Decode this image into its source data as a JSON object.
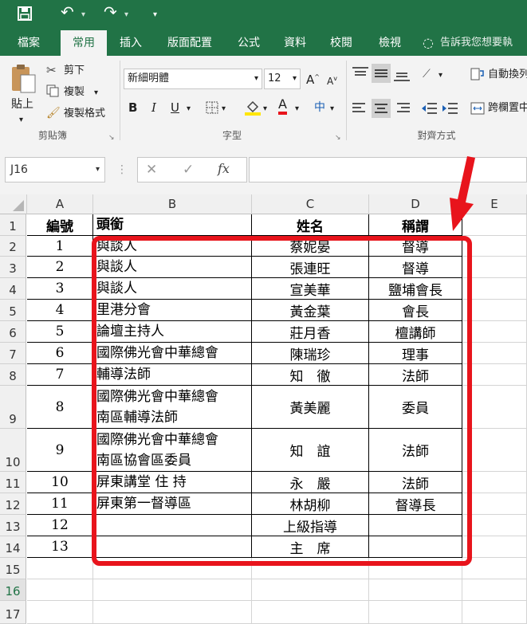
{
  "quick_access": {
    "undo_icon": "↶",
    "redo_icon": "↷"
  },
  "tabs": [
    {
      "label": "檔案"
    },
    {
      "label": "常用"
    },
    {
      "label": "插入"
    },
    {
      "label": "版面配置"
    },
    {
      "label": "公式"
    },
    {
      "label": "資料"
    },
    {
      "label": "校閱"
    },
    {
      "label": "檢視"
    }
  ],
  "tell_me": "告訴我您想要執",
  "ribbon": {
    "clipboard": {
      "paste": "貼上",
      "cut": "剪下",
      "copy": "複製",
      "format_painter": "複製格式",
      "group": "剪貼簿"
    },
    "font": {
      "name": "新細明體",
      "size": "12",
      "bold": "B",
      "italic": "I",
      "underline": "U",
      "font_color_letter": "A",
      "phonetic": "中",
      "group": "字型"
    },
    "alignment": {
      "wrap": "自動換列",
      "merge": "跨欄置中",
      "group": "對齊方式"
    }
  },
  "formula_bar": {
    "name_box": "J16",
    "cancel": "✕",
    "enter": "✓",
    "fx": "fx",
    "value": ""
  },
  "columns": [
    "A",
    "B",
    "C",
    "D",
    "E"
  ],
  "rows": [
    "1",
    "2",
    "3",
    "4",
    "5",
    "6",
    "7",
    "8",
    "9",
    "10",
    "11",
    "12",
    "13",
    "14",
    "15",
    "16",
    "17"
  ],
  "table": {
    "headers": {
      "a": "編號",
      "b": "頭銜",
      "c": "姓名",
      "d": "稱謂"
    },
    "rows": [
      {
        "a": "1",
        "b": "與談人",
        "c": "蔡妮晏",
        "d": "督導"
      },
      {
        "a": "2",
        "b": "與談人",
        "c": "張連旺",
        "d": "督導"
      },
      {
        "a": "3",
        "b": "與談人",
        "c": "宣美華",
        "d": "鹽埔會長"
      },
      {
        "a": "4",
        "b": "里港分會",
        "c": "黃金葉",
        "d": "會長"
      },
      {
        "a": "5",
        "b": "論壇主持人",
        "c": "莊月香",
        "d": "檀講師"
      },
      {
        "a": "6",
        "b": "國際佛光會中華總會",
        "c": "陳瑞珍",
        "d": "理事"
      },
      {
        "a": "7",
        "b": "輔導法師",
        "c": "知　徹",
        "d": "法師"
      },
      {
        "a": "8",
        "b": "國際佛光會中華總會\n南區輔導法師",
        "c": "黃美麗",
        "d": "委員"
      },
      {
        "a": "9",
        "b": "國際佛光會中華總會\n南區協會區委員",
        "c": "知　誼",
        "d": "法師"
      },
      {
        "a": "10",
        "b": "屏東講堂 住 持",
        "c": "永　嚴",
        "d": "法師"
      },
      {
        "a": "11",
        "b": "屏東第一督導區",
        "c": "林胡柳",
        "d": "督導長"
      },
      {
        "a": "12",
        "b": "",
        "c": "上級指導",
        "d": ""
      },
      {
        "a": "13",
        "b": "",
        "c": "主　席",
        "d": ""
      }
    ]
  },
  "colors": {
    "excel_green": "#217346",
    "highlight_red": "#e8141c",
    "font_color_bar": "#e8141c",
    "fill_color_bar": "#ffe600"
  }
}
